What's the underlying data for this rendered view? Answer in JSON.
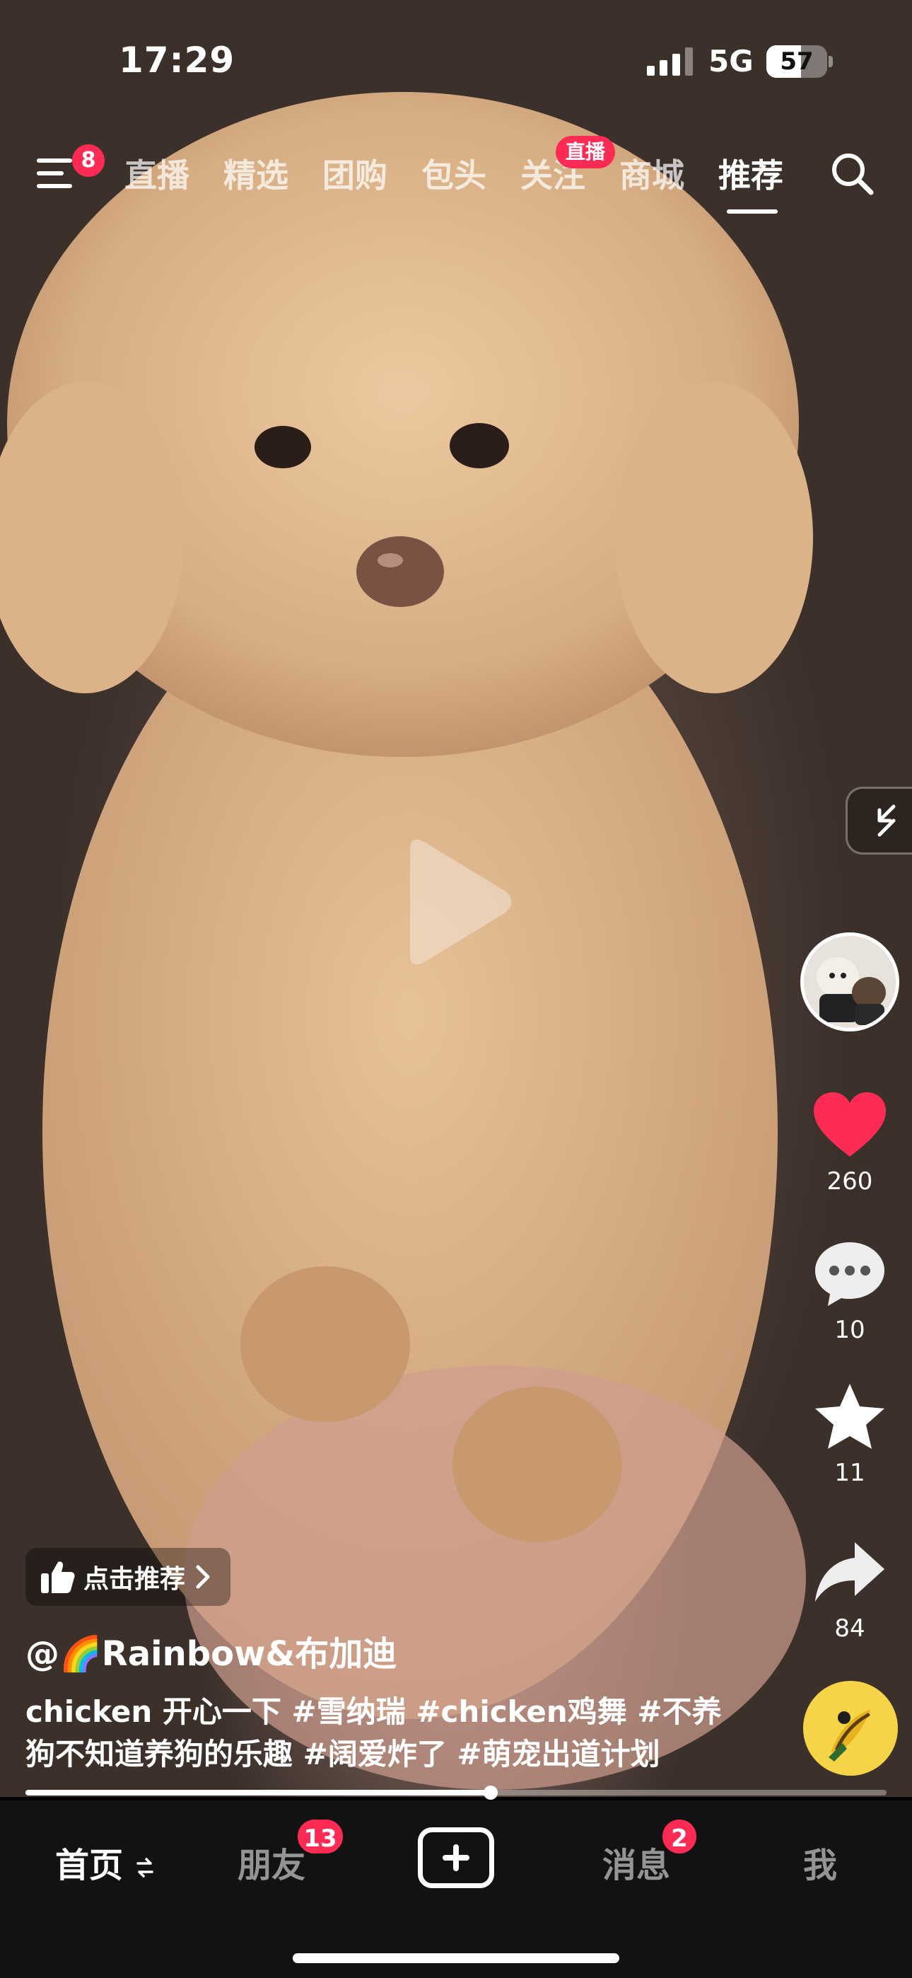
{
  "status_bar": {
    "time": "17:29",
    "network": "5G",
    "battery": "57",
    "battery_level": 0.57
  },
  "top_nav": {
    "menu_badge": "8",
    "tabs": [
      {
        "label": "直播"
      },
      {
        "label": "精选"
      },
      {
        "label": "团购"
      },
      {
        "label": "包头"
      },
      {
        "label": "关注"
      },
      {
        "label": "商城"
      },
      {
        "label": "推荐"
      }
    ],
    "active_tab": "推荐",
    "follow_live_tag": "直播"
  },
  "side_actions": {
    "likes": "260",
    "comments": "10",
    "favorites": "11",
    "shares": "84",
    "like_color": "#fe2c55"
  },
  "video": {
    "recommend_label": "点击推荐",
    "author": "@🌈Rainbow&布加迪",
    "caption_lines": [
      "chicken 开心一下 #雪纳瑞 #chicken鸡舞 #不养",
      "狗不知道养狗的乐趣 #阔爱炸了 #萌宠出道计划"
    ],
    "progress": 0.54
  },
  "bottom_nav": {
    "home": "首页",
    "friends": "朋友",
    "friends_badge": "13",
    "messages": "消息",
    "messages_badge": "2",
    "me": "我"
  },
  "colors": {
    "accent": "#fe2c55",
    "bar_bg": "#121212"
  },
  "icons": [
    "menu-icon",
    "search-icon",
    "play-icon",
    "collapse-icon",
    "heart-icon",
    "comment-icon",
    "star-icon",
    "share-icon",
    "thumbs-up-icon",
    "chevron-right-icon",
    "plus-icon",
    "swap-icon",
    "music-disc-icon"
  ]
}
